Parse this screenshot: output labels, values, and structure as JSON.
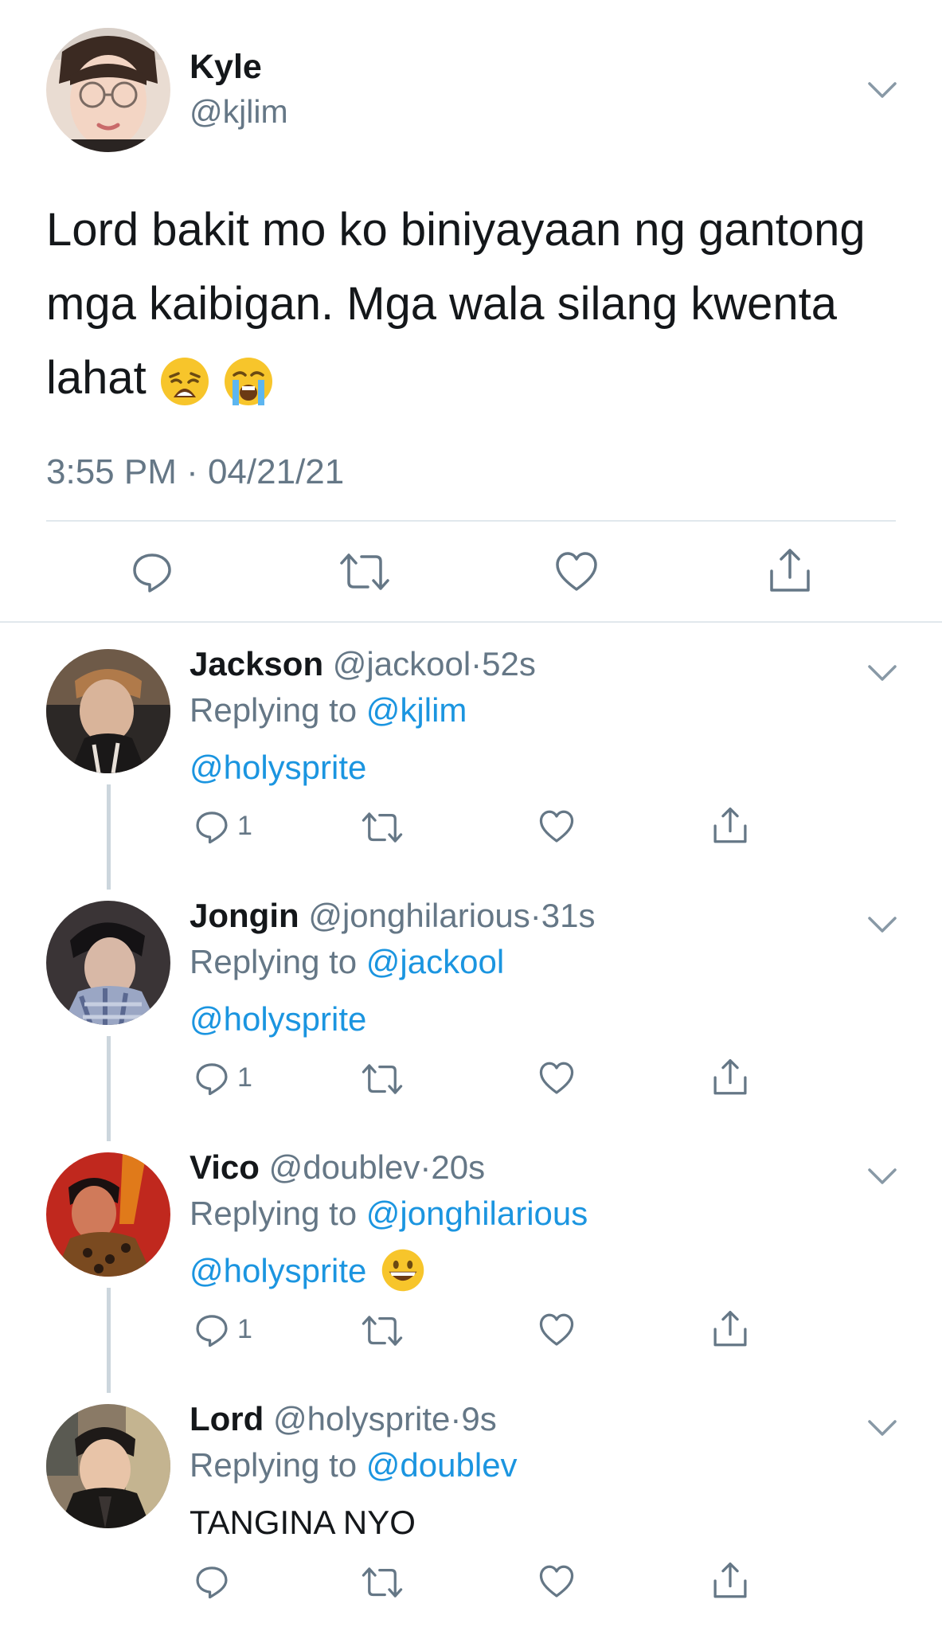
{
  "main_tweet": {
    "name": "Kyle",
    "handle": "@kjlim",
    "text": "Lord bakit mo ko biniyayaan ng gantong mga kaibigan. Mga wala silang kwenta lahat",
    "emojis": [
      "weary-face-emoji",
      "loudly-crying-face-emoji"
    ],
    "timestamp": "3:55 PM · 04/21/21",
    "icons": [
      "reply-icon",
      "retweet-icon",
      "like-icon",
      "share-icon"
    ]
  },
  "replies": [
    {
      "name": "Jackson",
      "handle": "@jackool",
      "age": "52s",
      "replying_label": "Replying to ",
      "replying_to": "@kjlim",
      "body_mention": "@holysprite",
      "body_text": "",
      "reply_count": "1",
      "avatar_color": "#5b4a3a"
    },
    {
      "name": "Jongin",
      "handle": "@jonghilarious",
      "age": "31s",
      "replying_label": "Replying to ",
      "replying_to": "@jackool",
      "body_mention": "@holysprite",
      "body_text": "",
      "reply_count": "1",
      "avatar_color": "#2e2a2c"
    },
    {
      "name": "Vico",
      "handle": "@doublev",
      "age": "20s",
      "replying_label": "Replying to ",
      "replying_to": "@jonghilarious",
      "body_mention": "@holysprite",
      "body_text": "",
      "body_emoji": "grinning-face-emoji",
      "reply_count": "1",
      "avatar_color": "#b8241c"
    },
    {
      "name": "Lord",
      "handle": "@holysprite",
      "age": "9s",
      "replying_label": "Replying to ",
      "replying_to": "@doublev",
      "body_mention": "",
      "body_text": "TANGINA NYO",
      "reply_count": "",
      "avatar_color": "#3a3532"
    }
  ],
  "separator": "·",
  "colors": {
    "link": "#1b95e0",
    "secondary_text": "#657786",
    "primary_text": "#14171a",
    "divider": "#e1e8ed",
    "thread_line": "#ccd6dd"
  }
}
